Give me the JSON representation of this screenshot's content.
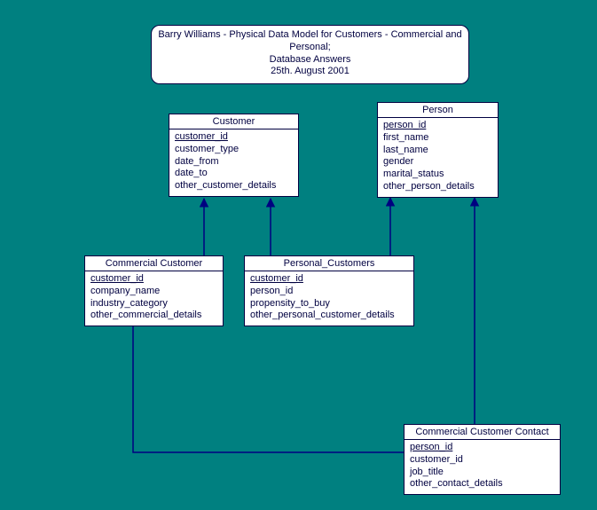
{
  "title": {
    "line1": "Barry Williams - Physical Data Model for Customers - Commercial and Personal;",
    "line2": "Database Answers",
    "line3": "25th. August 2001"
  },
  "entities": {
    "customer": {
      "name": "Customer",
      "attrs": [
        "customer_id",
        "customer_type",
        "date_from",
        "date_to",
        "other_customer_details"
      ],
      "pk": [
        0
      ]
    },
    "person": {
      "name": "Person",
      "attrs": [
        "person_id",
        "first_name",
        "last_name",
        "gender",
        "marital_status",
        "other_person_details"
      ],
      "pk": [
        0
      ]
    },
    "commercial_customer": {
      "name": "Commercial Customer",
      "attrs": [
        "customer_id",
        "company_name",
        "industry_category",
        "other_commercial_details"
      ],
      "pk": [
        0
      ]
    },
    "personal_customers": {
      "name": "Personal_Customers",
      "attrs": [
        "customer_id",
        "person_id",
        "propensity_to_buy",
        "other_personal_customer_details"
      ],
      "pk": [
        0
      ]
    },
    "commercial_customer_contact": {
      "name": "Commercial Customer Contact",
      "attrs": [
        "person_id",
        "customer_id",
        "job_title",
        "other_contact_details"
      ],
      "pk": [
        0
      ]
    }
  },
  "chart_data": {
    "type": "erd",
    "entities": [
      {
        "id": "customer",
        "name": "Customer",
        "attributes": [
          "customer_id",
          "customer_type",
          "date_from",
          "date_to",
          "other_customer_details"
        ],
        "primary_key": [
          "customer_id"
        ]
      },
      {
        "id": "person",
        "name": "Person",
        "attributes": [
          "person_id",
          "first_name",
          "last_name",
          "gender",
          "marital_status",
          "other_person_details"
        ],
        "primary_key": [
          "person_id"
        ]
      },
      {
        "id": "commercial_customer",
        "name": "Commercial Customer",
        "attributes": [
          "customer_id",
          "company_name",
          "industry_category",
          "other_commercial_details"
        ],
        "primary_key": [
          "customer_id"
        ]
      },
      {
        "id": "personal_customers",
        "name": "Personal_Customers",
        "attributes": [
          "customer_id",
          "person_id",
          "propensity_to_buy",
          "other_personal_customer_details"
        ],
        "primary_key": [
          "customer_id"
        ]
      },
      {
        "id": "commercial_customer_contact",
        "name": "Commercial Customer Contact",
        "attributes": [
          "person_id",
          "customer_id",
          "job_title",
          "other_contact_details"
        ],
        "primary_key": [
          "person_id"
        ]
      }
    ],
    "relationships": [
      {
        "from": "commercial_customer",
        "to": "customer",
        "fk": "customer_id"
      },
      {
        "from": "personal_customers",
        "to": "customer",
        "fk": "customer_id"
      },
      {
        "from": "personal_customers",
        "to": "person",
        "fk": "person_id"
      },
      {
        "from": "commercial_customer_contact",
        "to": "commercial_customer",
        "fk": "customer_id"
      },
      {
        "from": "commercial_customer_contact",
        "to": "person",
        "fk": "person_id"
      }
    ]
  },
  "colors": {
    "bg": "#008080",
    "box": "#ffffff",
    "line": "#000080"
  }
}
